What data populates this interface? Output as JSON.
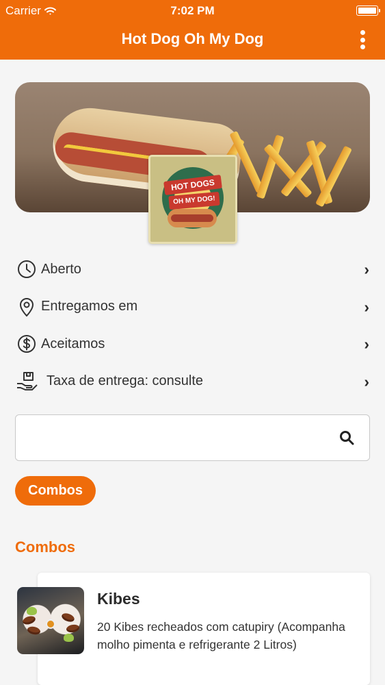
{
  "status_bar": {
    "carrier": "Carrier",
    "time": "7:02 PM"
  },
  "header": {
    "title": "Hot Dog Oh My Dog",
    "menu_icon": "more-vertical-icon"
  },
  "banner": {
    "logo_text_top": "HOT DOGS",
    "logo_text_bottom": "OH MY DOG!"
  },
  "info": {
    "rows": [
      {
        "label": "Aberto",
        "icon": "clock-icon"
      },
      {
        "label": "Entregamos em",
        "icon": "map-pin-icon"
      },
      {
        "label": "Aceitamos",
        "icon": "dollar-circle-icon"
      },
      {
        "label": "Taxa de entrega: consulte",
        "icon": "delivery-hand-icon"
      }
    ],
    "chevron": "›"
  },
  "search": {
    "value": "",
    "placeholder": ""
  },
  "categories": {
    "chips": [
      {
        "label": "Combos"
      }
    ]
  },
  "sections": [
    {
      "title": "Combos",
      "items": [
        {
          "name": "Kibes",
          "description": "20 Kibes recheados com catupiry (Acompanha molho pimenta e refrigerante 2 Litros)"
        }
      ]
    }
  ],
  "colors": {
    "accent": "#ef6c0a",
    "background": "#f5f5f5",
    "text": "#333333"
  }
}
